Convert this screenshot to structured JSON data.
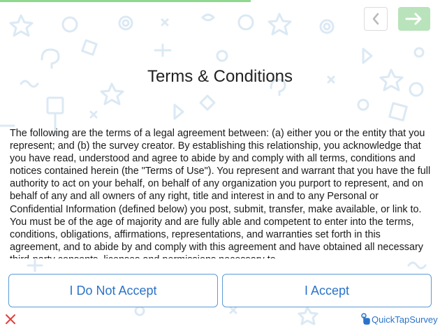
{
  "progress": {
    "fraction": 0.57
  },
  "nav": {
    "back_icon": "chevron-left-icon",
    "next_icon": "arrow-right-icon"
  },
  "page": {
    "title": "Terms & Conditions",
    "terms_text": "The following are the terms of a legal agreement between: (a) either you or the entity that you represent; and (b) the survey creator. By establishing this relationship, you acknowledge that you have read, understood and agree to abide by and comply with all terms, conditions and notices contained herein (the \"Terms of Use\"). You represent and warrant that you have the full authority to act on your behalf, on behalf of any organization you purport to represent, and on behalf of any and all owners of any right, title and interest in and to any Personal or Confidential Information (defined below) you post, submit, transfer, make available, or link to. You must be of the age of majority and are fully able and competent to enter into the terms, conditions, obligations, affirmations, representations, and warranties set forth in this agreement, and to abide by and comply with this agreement and have obtained all necessary third-party consents, licenses and permissions necessary to"
  },
  "buttons": {
    "decline_label": "I Do Not Accept",
    "accept_label": "I Accept"
  },
  "footer": {
    "brand_name": "QuickTapSurvey",
    "close_icon": "close-icon"
  },
  "colors": {
    "accent": "#2a73c9",
    "next_button": "#b9e3bb",
    "progress": "#8fd88f",
    "close": "#e0403a",
    "pattern": "#dbe9f4"
  }
}
